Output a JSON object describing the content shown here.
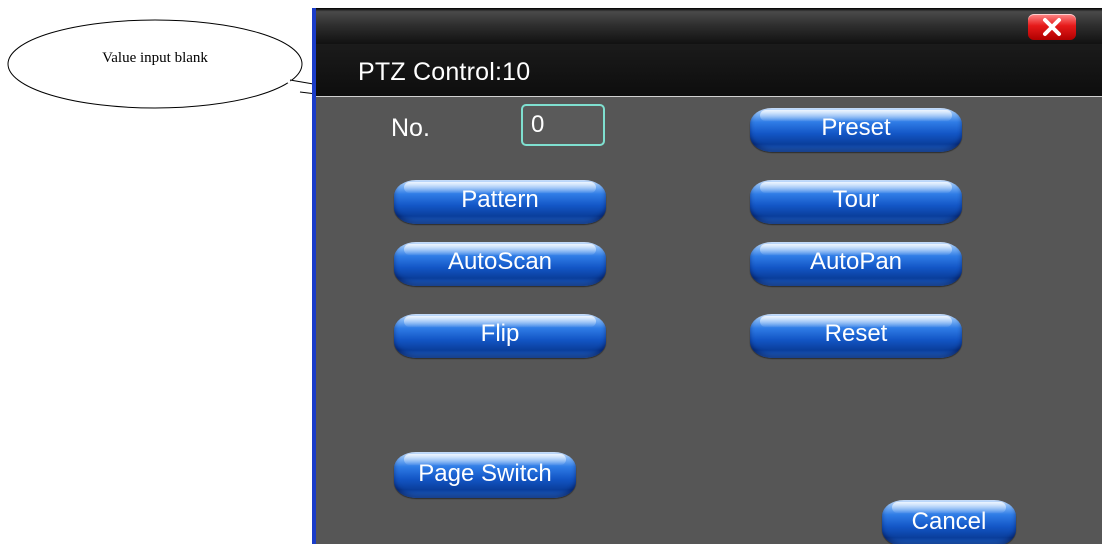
{
  "callout": {
    "text": "Value input blank"
  },
  "dialog": {
    "title": "PTZ Control:10",
    "no_label": "No.",
    "no_value": "0"
  },
  "buttons": {
    "preset": "Preset",
    "pattern": "Pattern",
    "tour": "Tour",
    "autoscan": "AutoScan",
    "autopan": "AutoPan",
    "flip": "Flip",
    "reset": "Reset",
    "page_switch": "Page Switch",
    "cancel": "Cancel"
  },
  "icons": {
    "close": "close-icon"
  },
  "colors": {
    "window_border": "#1a3cc8",
    "panel_background": "#565656",
    "input_border": "#7fe0d0",
    "button_blue": "#1356c6",
    "close_red": "#e61a1a"
  }
}
